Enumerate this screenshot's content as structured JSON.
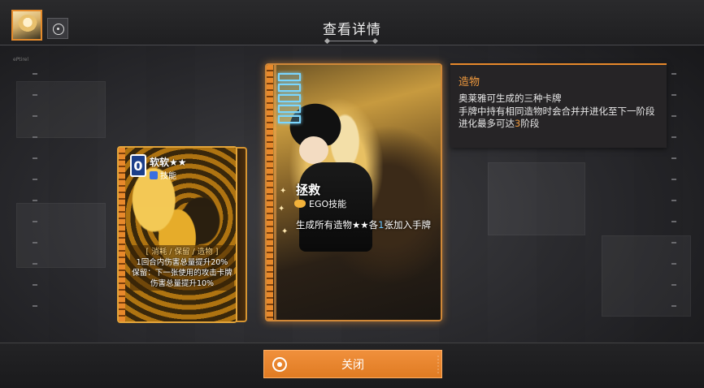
{
  "header": {
    "title": "查看详情",
    "faint_text": "ePtirel",
    "avatar_icon": "character-portrait",
    "target_icon": "target-icon"
  },
  "small_card": {
    "cost": "0",
    "name": "软软★★",
    "type": "技能",
    "desc_tags": "[ 消耗 / 保留 / 造物 ]",
    "desc_line1": "1回合内伤害总量提升20%",
    "desc_line2": "保留：下一张使用的攻击卡牌伤害总量提升10%"
  },
  "big_card": {
    "cost_pips": 5,
    "name": "拯救",
    "type": "EGO技能",
    "desc_pre": "生成所有造物★★各",
    "desc_num": "1",
    "desc_post": "张加入手牌"
  },
  "info_panel": {
    "title": "造物",
    "line1": "奥莱雅可生成的三种卡牌",
    "line2": "手牌中持有相同造物时会合并并进化至下一阶段",
    "line3_pre": "进化最多可达",
    "line3_num": "3",
    "line3_post": "阶段"
  },
  "footer": {
    "close_label": "关闭"
  },
  "colors": {
    "accent": "#e8892b",
    "highlight_blue": "#6ec6ff",
    "panel_bg": "#262426"
  }
}
